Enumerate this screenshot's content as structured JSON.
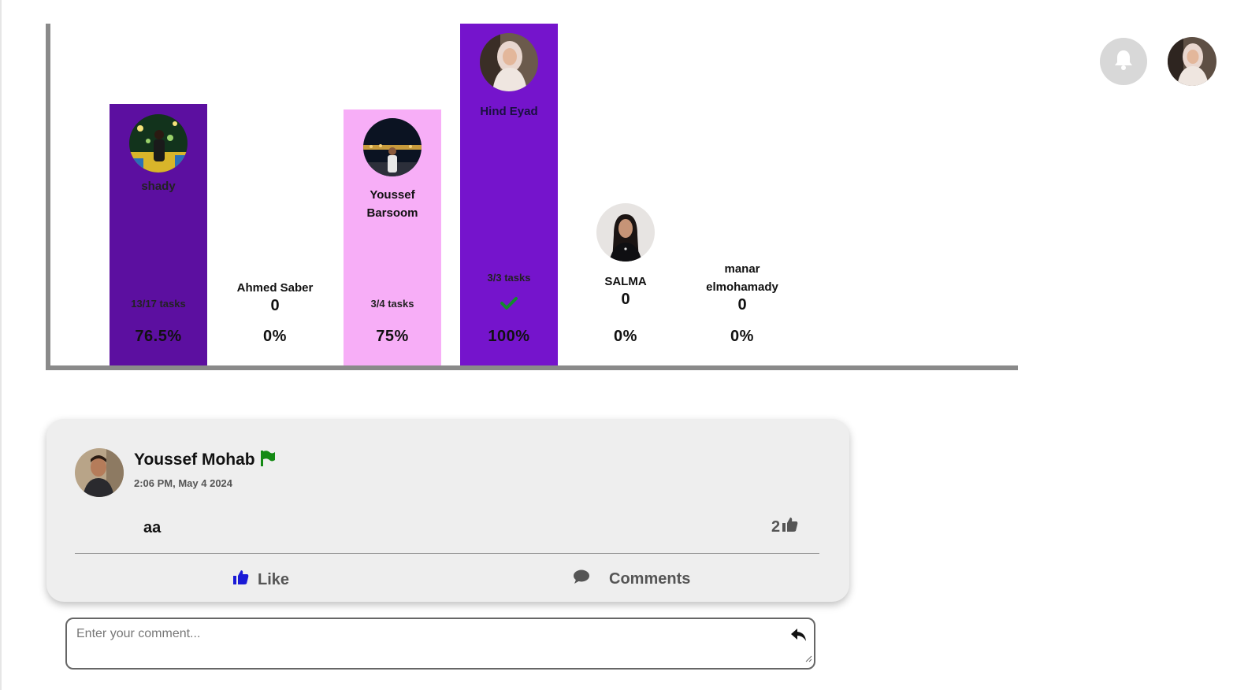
{
  "chart_data": {
    "type": "bar",
    "categories": [
      "shady",
      "Ahmed Saber",
      "Youssef Barsoom",
      "Hind Eyad",
      "SALMA",
      "manar elmohamady"
    ],
    "values": [
      76.5,
      0,
      75,
      100,
      0,
      0
    ],
    "ylim": [
      0,
      100
    ]
  },
  "members": [
    {
      "name": "shady",
      "count": "",
      "tasks": "13/17 tasks",
      "percent": "76.5%",
      "color": "#5c0fa0"
    },
    {
      "name": "Ahmed Saber",
      "count": "0",
      "tasks": "",
      "percent": "0%",
      "color": ""
    },
    {
      "name": "Youssef Barsoom",
      "count": "",
      "tasks": "3/4 tasks",
      "percent": "75%",
      "color": "#f7aef7"
    },
    {
      "name": "Hind Eyad",
      "count": "",
      "tasks": "3/3 tasks",
      "percent": "100%",
      "color": "#7514cc"
    },
    {
      "name": "SALMA",
      "count": "0",
      "tasks": "",
      "percent": "0%",
      "color": ""
    },
    {
      "name": "manar elmohamady",
      "count": "0",
      "tasks": "",
      "percent": "0%",
      "color": ""
    }
  ],
  "header": {
    "bell_icon": "bell-icon",
    "profile_avatar": "avatar"
  },
  "post": {
    "author": "Youssef Mohab",
    "flag_icon": "flag-icon",
    "flag_color": "#148a14",
    "time": "2:06 PM, May 4 2024",
    "text": "aa",
    "likes_count": "2",
    "like_label": "Like",
    "like_color": "#1a1ad6",
    "comments_label": "Comments"
  },
  "comment_box": {
    "placeholder": "Enter your comment...",
    "send_icon": "reply-icon"
  }
}
